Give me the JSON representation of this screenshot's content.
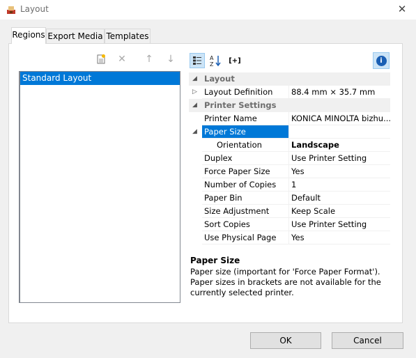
{
  "window": {
    "title": "Layout",
    "close_glyph": "✕"
  },
  "tabs": [
    "Regions",
    "Export Media",
    "Templates"
  ],
  "regions_toolbar": {
    "icons": [
      "new-region-icon",
      "delete-icon",
      "move-up-icon",
      "move-down-icon"
    ],
    "glyphs": [
      "",
      "✕",
      "↑",
      "↓"
    ]
  },
  "regions": [
    "Standard Layout"
  ],
  "grid_toolbar": {
    "icons": [
      "categorized-view-icon",
      "alphabetical-sort-icon",
      "expand-collapse-icon",
      "info-icon"
    ],
    "expand_glyph": "[+]",
    "info_glyph": "i"
  },
  "properties": [
    {
      "type": "category",
      "label": "Layout",
      "expander": "◢"
    },
    {
      "type": "prop",
      "name": "Layout Definition",
      "value": "88.4 mm × 35.7 mm",
      "expander": "▷"
    },
    {
      "type": "category",
      "label": "Printer Settings",
      "expander": "◢"
    },
    {
      "type": "prop",
      "name": "Printer Name",
      "value": "KONICA MINOLTA bizhu...",
      "expander": ""
    },
    {
      "type": "prop",
      "name": "Paper Size",
      "value": "",
      "expander": "◢",
      "selected": true
    },
    {
      "type": "prop",
      "name": "Orientation",
      "value": "Landscape",
      "expander": "",
      "indent": true,
      "bold_value": true
    },
    {
      "type": "prop",
      "name": "Duplex",
      "value": "Use Printer Setting",
      "expander": ""
    },
    {
      "type": "prop",
      "name": "Force Paper Size",
      "value": "Yes",
      "expander": ""
    },
    {
      "type": "prop",
      "name": "Number of Copies",
      "value": "1",
      "expander": ""
    },
    {
      "type": "prop",
      "name": "Paper Bin",
      "value": "Default",
      "expander": ""
    },
    {
      "type": "prop",
      "name": "Size Adjustment",
      "value": "Keep Scale",
      "expander": ""
    },
    {
      "type": "prop",
      "name": "Sort Copies",
      "value": "Use Printer Setting",
      "expander": ""
    },
    {
      "type": "prop",
      "name": "Use Physical Page",
      "value": "Yes",
      "expander": ""
    }
  ],
  "description": {
    "title": "Paper Size",
    "body": "Paper size (important for 'Force Paper Format'). Paper sizes in brackets are not available for the currently selected printer."
  },
  "buttons": {
    "ok": "OK",
    "cancel": "Cancel"
  },
  "colors": {
    "selection": "#0078d7",
    "info_button": "#cce4f7",
    "categorized_button": "#cce4f7"
  }
}
